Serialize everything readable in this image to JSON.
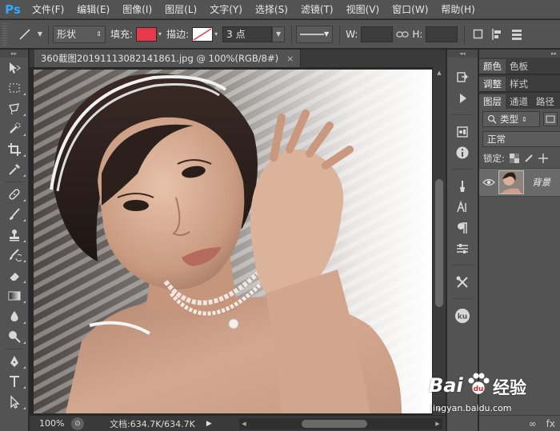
{
  "app": {
    "logo": "Ps"
  },
  "menu": [
    "文件(F)",
    "编辑(E)",
    "图像(I)",
    "图层(L)",
    "文字(Y)",
    "选择(S)",
    "滤镜(T)",
    "视图(V)",
    "窗口(W)",
    "帮助(H)"
  ],
  "options": {
    "mode": "形状",
    "fill_label": "填充:",
    "fill_color": "#e8394a",
    "stroke_label": "描边:",
    "stroke_width": "3 点",
    "w_label": "W:",
    "h_label": "H:"
  },
  "document": {
    "tab_title": "360截图20191113082141861.jpg @ 100%(RGB/8#)",
    "close_symbol": "×"
  },
  "status": {
    "zoom": "100%",
    "doc_info": "文档:634.7K/634.7K"
  },
  "panels": {
    "tabs_row1": [
      "颜色",
      "色板"
    ],
    "tabs_row2": [
      "调整",
      "样式"
    ],
    "tabs_row3": [
      "图层",
      "通道",
      "路径"
    ],
    "filter_label": "类型",
    "blend_mode": "正常",
    "lock_label": "锁定:",
    "layer_name": "背景",
    "bottom_icons": [
      "∞",
      "fx"
    ]
  },
  "watermark": {
    "brand_left": "Bai",
    "brand_right": "经验",
    "url": "jingyan.baidu.com"
  },
  "colors": {
    "ui_panel": "#535353",
    "ui_dark": "#282828",
    "ps_blue": "#31a8ff"
  },
  "icons": [
    "line-tool-icon",
    "move-icon",
    "marquee-icon",
    "lasso-icon",
    "quick-select-icon",
    "crop-icon",
    "eyedropper-icon",
    "healing-brush-icon",
    "brush-icon",
    "clone-stamp-icon",
    "history-brush-icon",
    "eraser-icon",
    "gradient-icon",
    "blur-icon",
    "dodge-icon",
    "pen-icon",
    "type-icon",
    "path-select-icon",
    "eye-icon",
    "link-icon"
  ]
}
